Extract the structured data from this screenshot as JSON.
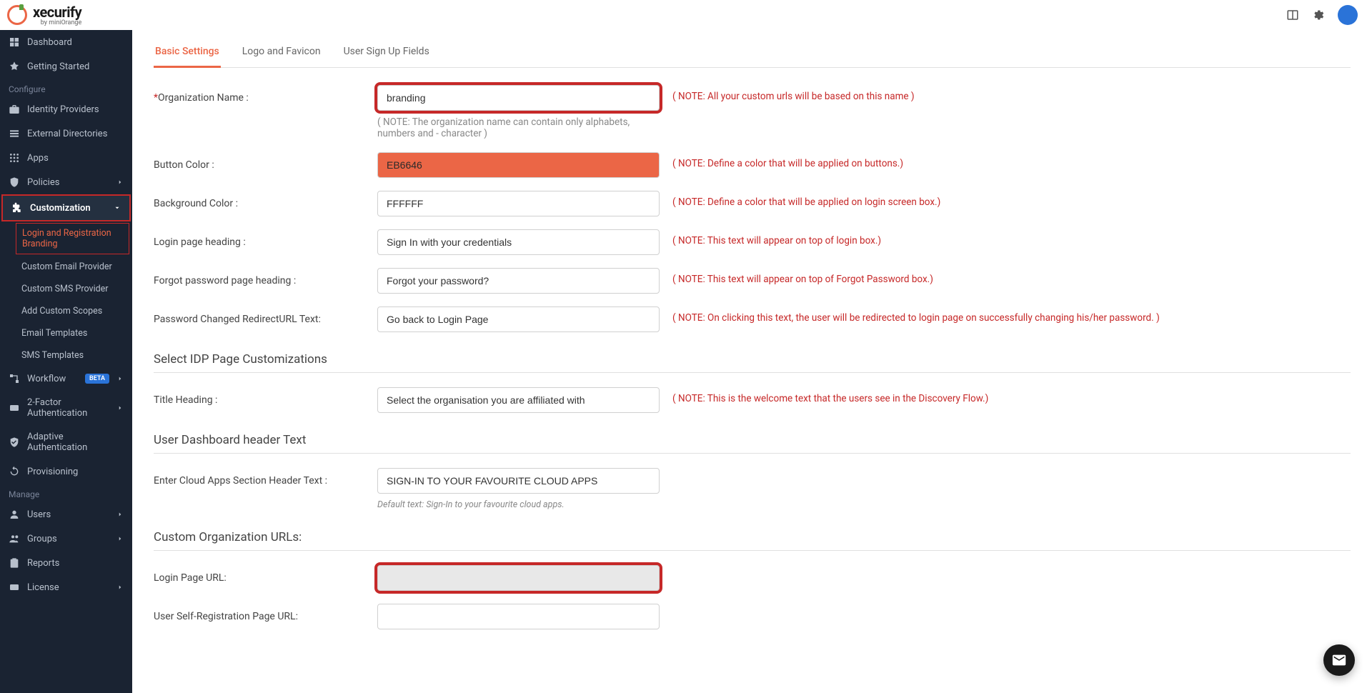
{
  "header": {
    "brand": "xecurify",
    "brandSub": "by miniOrange"
  },
  "sidebar": {
    "items": [
      {
        "label": "Dashboard",
        "icon": "dashboard"
      },
      {
        "label": "Getting Started",
        "icon": "rocket"
      }
    ],
    "sections": [
      {
        "label": "Configure",
        "items": [
          {
            "label": "Identity Providers",
            "icon": "briefcase"
          },
          {
            "label": "External Directories",
            "icon": "list"
          },
          {
            "label": "Apps",
            "icon": "grid"
          },
          {
            "label": "Policies",
            "icon": "shield-gear",
            "chevron": "right"
          },
          {
            "label": "Customization",
            "icon": "puzzle",
            "chevron": "down",
            "active": true,
            "boxed": true,
            "subItems": [
              {
                "label": "Login and Registration Branding",
                "active": true
              },
              {
                "label": "Custom Email Provider"
              },
              {
                "label": "Custom SMS Provider"
              },
              {
                "label": "Add Custom Scopes"
              },
              {
                "label": "Email Templates"
              },
              {
                "label": "SMS Templates"
              }
            ]
          },
          {
            "label": "Workflow",
            "icon": "workflow",
            "badge": "BETA",
            "chevron": "right"
          },
          {
            "label": "2-Factor Authentication",
            "icon": "tfa",
            "chevron": "right"
          },
          {
            "label": "Adaptive Authentication",
            "icon": "shield-check"
          },
          {
            "label": "Provisioning",
            "icon": "sync"
          }
        ]
      },
      {
        "label": "Manage",
        "items": [
          {
            "label": "Users",
            "icon": "user",
            "chevron": "right"
          },
          {
            "label": "Groups",
            "icon": "users",
            "chevron": "right"
          },
          {
            "label": "Reports",
            "icon": "clipboard"
          },
          {
            "label": "License",
            "icon": "card",
            "chevron": "right"
          }
        ]
      }
    ]
  },
  "tabs": [
    {
      "label": "Basic Settings",
      "active": true
    },
    {
      "label": "Logo and Favicon"
    },
    {
      "label": "User Sign Up Fields"
    }
  ],
  "form": {
    "orgName": {
      "label": "Organization Name :",
      "value": "branding",
      "note": "( NOTE: All your custom urls will be based on this name )",
      "subNote": "( NOTE: The organization name can contain only alphabets, numbers and - character )"
    },
    "buttonColor": {
      "label": "Button Color :",
      "value": "EB6646",
      "note": "( NOTE: Define a color that will be applied on buttons.)"
    },
    "bgColor": {
      "label": "Background Color :",
      "value": "FFFFFF",
      "note": "( NOTE: Define a color that will be applied on login screen box.)"
    },
    "loginHeading": {
      "label": "Login page heading :",
      "value": "Sign In with your credentials",
      "note": "( NOTE: This text will appear on top of login box.)"
    },
    "forgotHeading": {
      "label": "Forgot password page heading :",
      "value": "Forgot your password?",
      "note": "( NOTE: This text will appear on top of Forgot Password box.)"
    },
    "pwdRedirect": {
      "label": "Password Changed RedirectURL Text:",
      "value": "Go back to Login Page",
      "note": "( NOTE: On clicking this text, the user will be redirected to login page on successfully changing his/her password. )"
    },
    "sectionIDP": "Select IDP Page Customizations",
    "titleHeading": {
      "label": "Title Heading :",
      "value": "Select the organisation you are affiliated with",
      "note": "( NOTE: This is the welcome text that the users see in the Discovery Flow.)"
    },
    "sectionDash": "User Dashboard header Text",
    "cloudApps": {
      "label": "Enter Cloud Apps Section Header Text :",
      "value": "SIGN-IN TO YOUR FAVOURITE CLOUD APPS",
      "subNote": "Default text: Sign-In to your favourite cloud apps."
    },
    "sectionURLs": "Custom Organization URLs:",
    "loginURL": {
      "label": "Login Page URL:"
    },
    "selfRegURL": {
      "label": "User Self-Registration Page URL:"
    }
  }
}
